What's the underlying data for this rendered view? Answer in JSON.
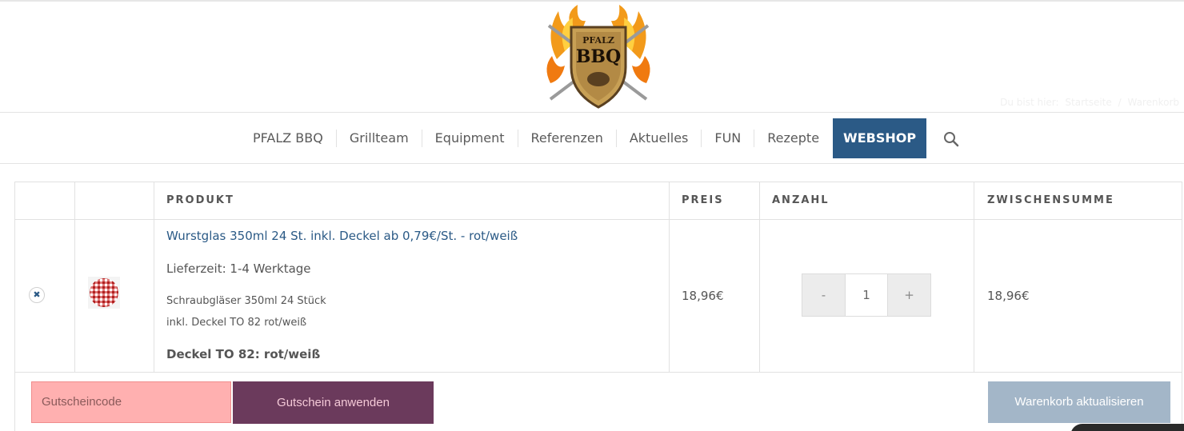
{
  "logo": {
    "text_top": "PFALZ",
    "text_main": "BBQ",
    "icon": "shield-flames-logo"
  },
  "breadcrumb": {
    "prefix": "Du bist hier:",
    "home": "Startseite",
    "sep": "/",
    "current": "Warenkorb"
  },
  "nav": {
    "items": [
      {
        "label": "PFALZ BBQ"
      },
      {
        "label": "Grillteam"
      },
      {
        "label": "Equipment"
      },
      {
        "label": "Referenzen"
      },
      {
        "label": "Aktuelles"
      },
      {
        "label": "FUN"
      },
      {
        "label": "Rezepte"
      },
      {
        "label": "WEBSHOP"
      }
    ],
    "search_icon": "search-icon",
    "active_color": "#2b5a86"
  },
  "cart": {
    "headers": {
      "product": "PRODUKT",
      "price": "PREIS",
      "quantity": "ANZAHL",
      "subtotal": "ZWISCHENSUMME"
    },
    "item": {
      "remove_symbol": "✖",
      "name": "Wurstglas 350ml 24 St. inkl. Deckel ab 0,79€/St. - rot/weiß",
      "delivery": "Lieferzeit: 1-4 Werktage",
      "desc_line1": "Schraubgläser 350ml 24 Stück",
      "desc_line2": "inkl. Deckel TO 82 rot/weiß",
      "variant": "Deckel TO 82: rot/weiß",
      "price": "18,96€",
      "qty_minus": "-",
      "qty_value": "1",
      "qty_plus": "+",
      "subtotal": "18,96€"
    }
  },
  "actions": {
    "coupon_placeholder": "Gutscheincode",
    "apply_label": "Gutschein anwenden",
    "update_label": "Warenkorb aktualisieren"
  },
  "colors": {
    "link": "#2b5a86",
    "coupon_bg": "#ffb0b0",
    "apply_bg": "#6b3a5c",
    "update_bg": "#a3b6c8"
  }
}
